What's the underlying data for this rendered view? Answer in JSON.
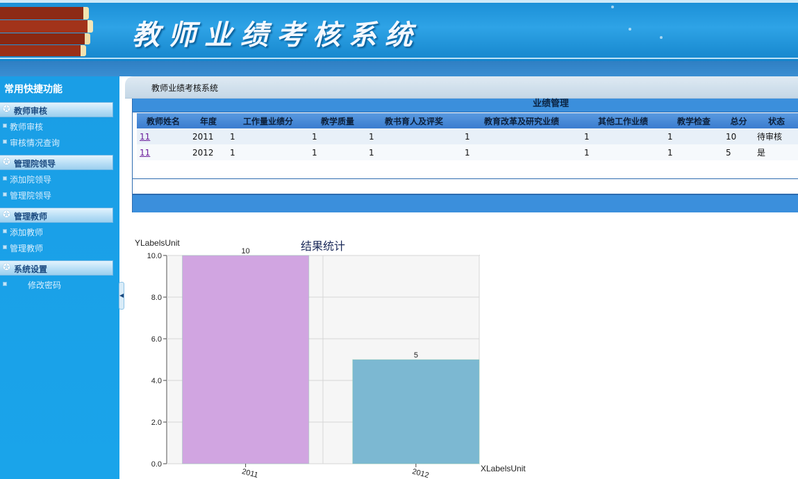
{
  "banner": {
    "title": "教师业绩考核系统"
  },
  "sidebar": {
    "title": "常用快捷功能",
    "sections": [
      {
        "label": "教师审核",
        "items": [
          "教师审核",
          "审核情况查询"
        ]
      },
      {
        "label": "管理院领导",
        "items": [
          "添加院领导",
          "管理院领导"
        ]
      },
      {
        "label": "管理教师",
        "items": [
          "添加教师",
          "管理教师"
        ]
      },
      {
        "label": "系统设置",
        "items": [
          "修改密码"
        ]
      }
    ]
  },
  "breadcrumb": "教师业绩考核系统",
  "panel": {
    "title": "业绩管理"
  },
  "table": {
    "columns": [
      "教师姓名",
      "年度",
      "工作量业绩分",
      "教学质量",
      "教书育人及评奖",
      "教育改革及研究业绩",
      "其他工作业绩",
      "教学检查",
      "总分",
      "状态"
    ],
    "rows": [
      [
        "11",
        "2011",
        "1",
        "1",
        "1",
        "1",
        "1",
        "1",
        "10",
        "待审核"
      ],
      [
        "11",
        "2012",
        "1",
        "1",
        "1",
        "1",
        "1",
        "1",
        "5",
        "是"
      ]
    ]
  },
  "chart_data": {
    "type": "bar",
    "title": "结果统计",
    "ylabel": "YLabelsUnit",
    "xlabel": "XLabelsUnit",
    "categories": [
      "2011",
      "2012"
    ],
    "values": [
      10,
      5
    ],
    "data_labels": [
      "10",
      "5"
    ],
    "ylim": [
      0,
      10
    ],
    "yticks": [
      "0.0",
      "2.0",
      "4.0",
      "6.0",
      "8.0",
      "10.0"
    ],
    "bar_colors": [
      "#d1a5e1",
      "#7cb8d2"
    ],
    "grid": true
  }
}
